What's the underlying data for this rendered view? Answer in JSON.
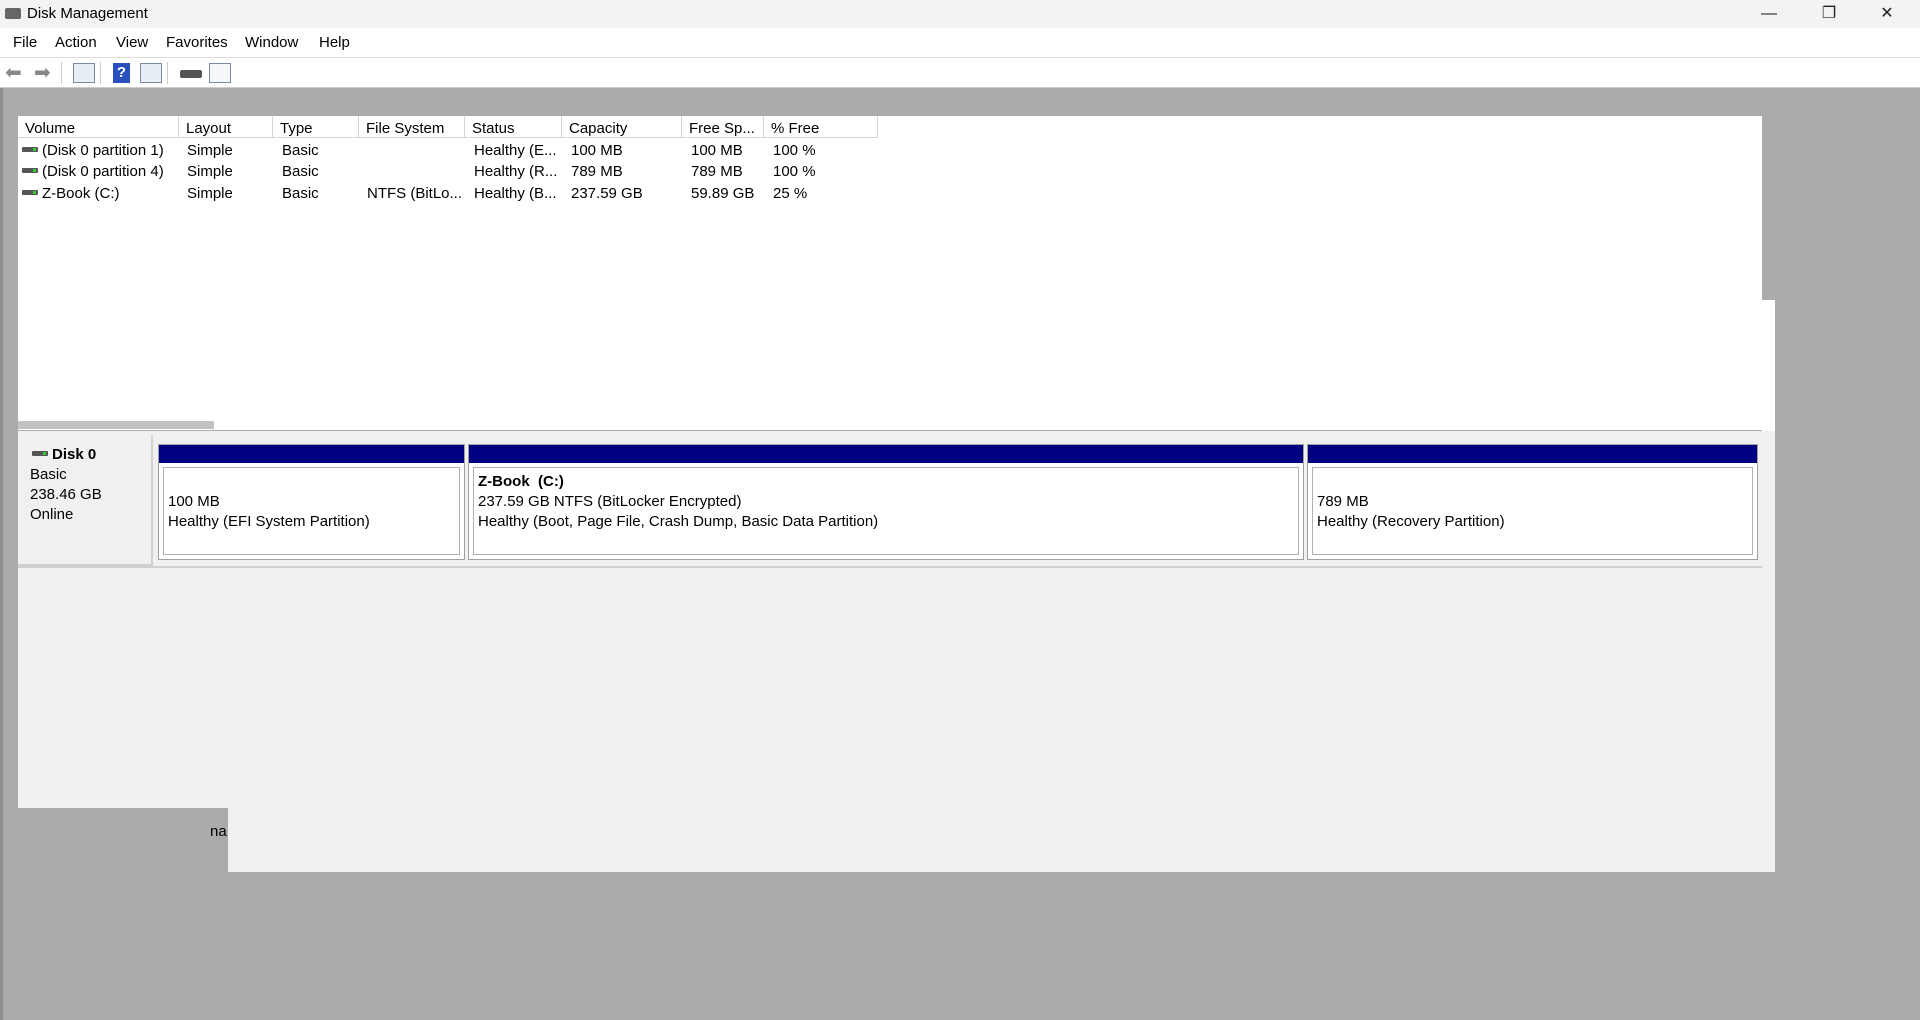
{
  "window": {
    "title": "Disk Management",
    "minimize": "—",
    "restore": "❐",
    "close": "✕"
  },
  "menu": [
    "File",
    "Action",
    "View",
    "Favorites",
    "Window",
    "Help"
  ],
  "toolbar": [
    "back-icon",
    "forward-icon",
    "show-hide-console-tree-icon",
    "help-icon",
    "show-hide-action-pane-icon",
    "connect-disk-icon",
    "properties-icon"
  ],
  "list": {
    "columns": [
      "Volume",
      "Layout",
      "Type",
      "File System",
      "Status",
      "Capacity",
      "Free Sp...",
      "% Free"
    ],
    "rows": [
      [
        "(Disk 0 partition 1)",
        "Simple",
        "Basic",
        "",
        "Healthy (E...",
        "100 MB",
        "100 MB",
        "100 %"
      ],
      [
        "(Disk 0 partition 4)",
        "Simple",
        "Basic",
        "",
        "Healthy (R...",
        "789 MB",
        "789 MB",
        "100 %"
      ],
      [
        "Z-Book (C:)",
        "Simple",
        "Basic",
        "NTFS (BitLo...",
        "Healthy (B...",
        "237.59 GB",
        "59.89 GB",
        "25 %"
      ]
    ]
  },
  "disk": {
    "name": "Disk 0",
    "type": "Basic",
    "size": "238.46 GB",
    "status": "Online",
    "partitions": [
      {
        "name": "",
        "size": "100 MB",
        "status": "Healthy (EFI System Partition)"
      },
      {
        "name": "Z-Book  (C:)",
        "size": "237.59 GB NTFS (BitLocker Encrypted)",
        "status": "Healthy (Boot, Page File, Crash Dump, Basic Data Partition)"
      },
      {
        "name": "",
        "size": "789 MB",
        "status": "Healthy (Recovery Partition)"
      }
    ]
  },
  "fragment": "na",
  "colors": {
    "partition_header": "#000080",
    "background": "#ababab"
  }
}
